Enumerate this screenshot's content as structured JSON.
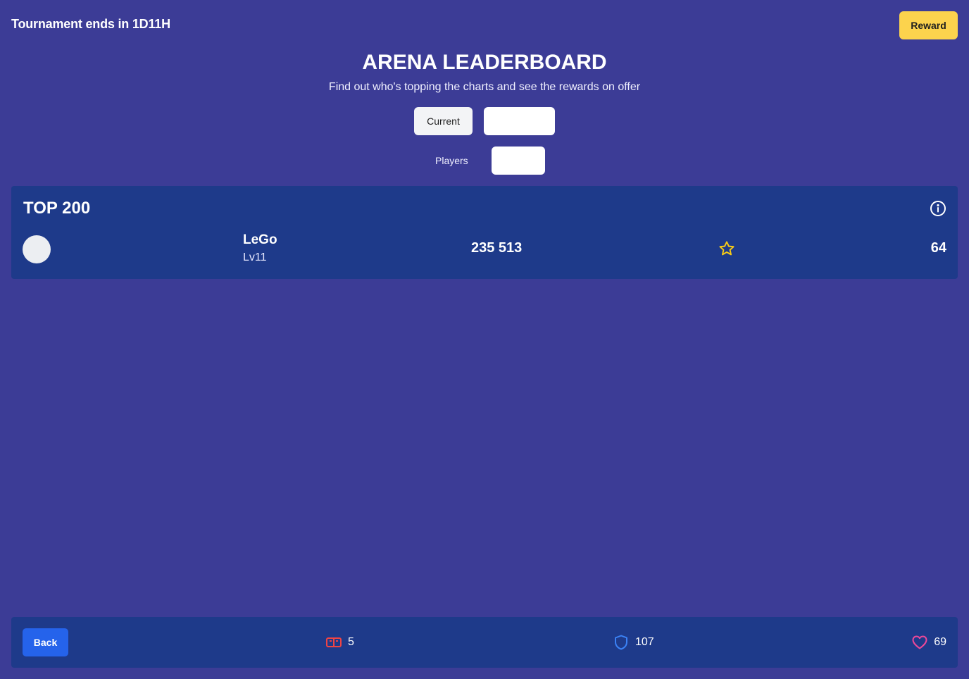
{
  "header": {
    "timer_text": "Tournament ends in 1D11H",
    "reward_label": "Reward"
  },
  "hero": {
    "title": "ARENA LEADERBOARD",
    "subtitle": "Find out who's topping the charts and see the rewards on offer"
  },
  "tabs": {
    "current_label": "Current",
    "second_label": ""
  },
  "filter": {
    "label": "Players",
    "value": ""
  },
  "leaderboard": {
    "title": "TOP 200",
    "info_icon": "info-icon",
    "rows": [
      {
        "name": "LeGo",
        "level": "Lv11",
        "score": "235 513",
        "star_icon": "star-icon",
        "points": "64"
      }
    ]
  },
  "footer": {
    "back_label": "Back",
    "stats": [
      {
        "icon": "ticket-icon",
        "value": "5",
        "color": "#ef4444"
      },
      {
        "icon": "shield-icon",
        "value": "107",
        "color": "#3b82f6"
      },
      {
        "icon": "heart-icon",
        "value": "69",
        "color": "#ec4899"
      }
    ]
  },
  "colors": {
    "background": "#3c3c96",
    "panel": "#1e3a8a",
    "reward": "#fcd34d",
    "back": "#2563eb",
    "star": "#facc15"
  }
}
